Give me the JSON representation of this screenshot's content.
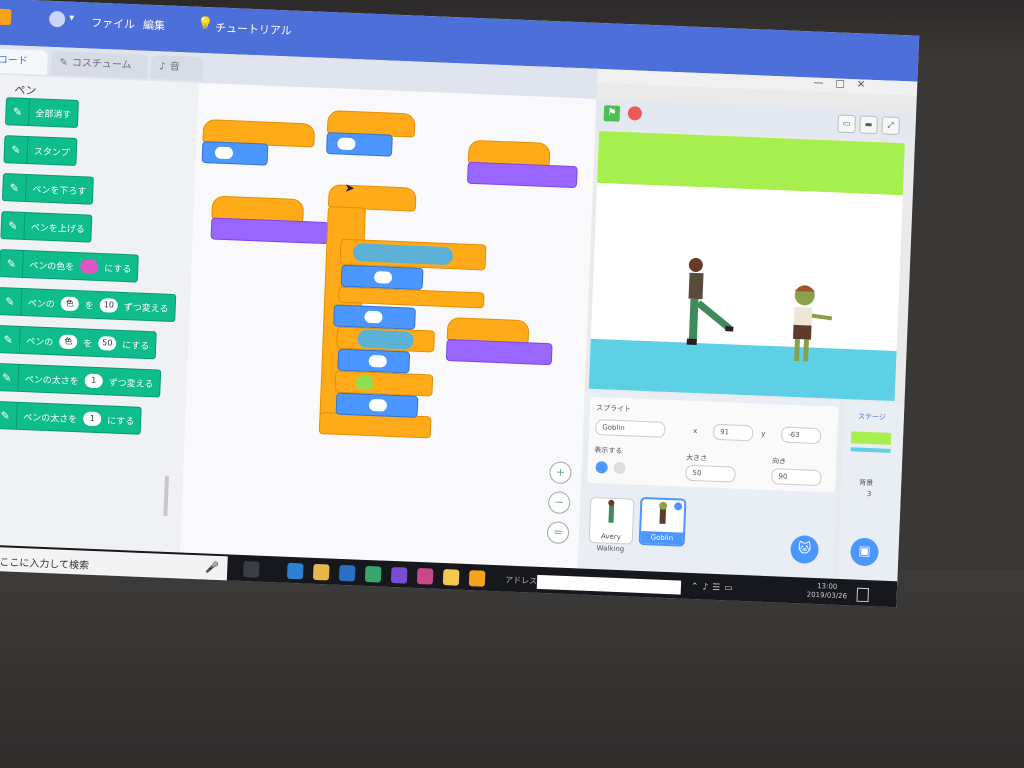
{
  "menubar": {
    "menus": [
      "ファイル",
      "編集"
    ],
    "tutorial": "チュートリアル"
  },
  "tabs": {
    "code": "コード",
    "costume": "コスチューム",
    "sound": "音"
  },
  "palette": {
    "category": "ペン",
    "blocks": [
      {
        "label": "全部消す"
      },
      {
        "label": "スタンプ"
      },
      {
        "label": "ペンを下ろす"
      },
      {
        "label": "ペンを上げる"
      },
      {
        "label": "ペンの色を",
        "suffix": "にする"
      },
      {
        "label": "ペンの",
        "dropdown": "色",
        "mid": "を",
        "value": "10",
        "suffix": "ずつ変える"
      },
      {
        "label": "ペンの",
        "dropdown": "色",
        "mid": "を",
        "value": "50",
        "suffix": "にする"
      },
      {
        "label": "ペンの太さを",
        "value": "1",
        "suffix": "ずつ変える"
      },
      {
        "label": "ペンの太さを",
        "value": "1",
        "suffix": "にする"
      }
    ]
  },
  "sprite_info": {
    "heading": "スプライト",
    "name": "Goblin",
    "x_label": "x",
    "x_value": "91",
    "y_label": "y",
    "y_value": "-63",
    "show_label": "表示する",
    "size_label": "大きさ",
    "size_value": "50",
    "direction_label": "向き",
    "direction_value": "90"
  },
  "sprites": [
    {
      "name": "Avery Walking"
    },
    {
      "name": "Goblin"
    }
  ],
  "stage_panel": {
    "title": "ステージ",
    "backdrops_label": "背景",
    "backdrops_count": "3"
  },
  "taskbar": {
    "search_placeholder": "ここに入力して検索",
    "address_label": "アドレス",
    "clock_time": "13:00",
    "clock_date": "2019/03/26"
  },
  "colors": {
    "accent": "#4c6fd9",
    "pen_block": "#0fbd8c",
    "events_block": "#ffab19",
    "looks_block": "#9966ff",
    "motion_block": "#4c97ff"
  }
}
